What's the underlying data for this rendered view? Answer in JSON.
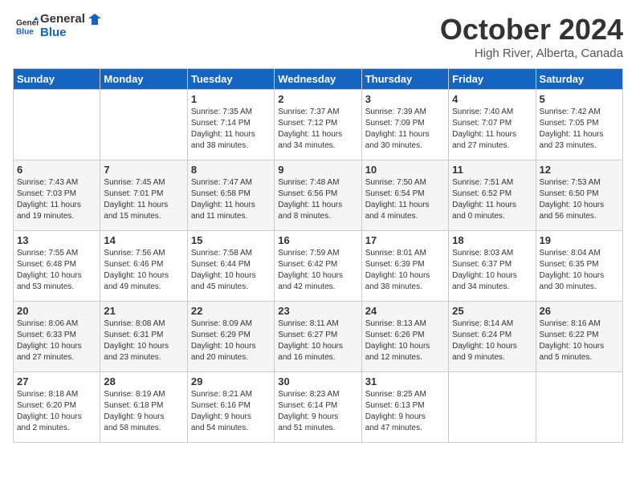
{
  "logo": {
    "line1": "General",
    "line2": "Blue"
  },
  "title": "October 2024",
  "location": "High River, Alberta, Canada",
  "weekdays": [
    "Sunday",
    "Monday",
    "Tuesday",
    "Wednesday",
    "Thursday",
    "Friday",
    "Saturday"
  ],
  "weeks": [
    [
      {
        "day": "",
        "info": ""
      },
      {
        "day": "",
        "info": ""
      },
      {
        "day": "1",
        "info": "Sunrise: 7:35 AM\nSunset: 7:14 PM\nDaylight: 11 hours\nand 38 minutes."
      },
      {
        "day": "2",
        "info": "Sunrise: 7:37 AM\nSunset: 7:12 PM\nDaylight: 11 hours\nand 34 minutes."
      },
      {
        "day": "3",
        "info": "Sunrise: 7:39 AM\nSunset: 7:09 PM\nDaylight: 11 hours\nand 30 minutes."
      },
      {
        "day": "4",
        "info": "Sunrise: 7:40 AM\nSunset: 7:07 PM\nDaylight: 11 hours\nand 27 minutes."
      },
      {
        "day": "5",
        "info": "Sunrise: 7:42 AM\nSunset: 7:05 PM\nDaylight: 11 hours\nand 23 minutes."
      }
    ],
    [
      {
        "day": "6",
        "info": "Sunrise: 7:43 AM\nSunset: 7:03 PM\nDaylight: 11 hours\nand 19 minutes."
      },
      {
        "day": "7",
        "info": "Sunrise: 7:45 AM\nSunset: 7:01 PM\nDaylight: 11 hours\nand 15 minutes."
      },
      {
        "day": "8",
        "info": "Sunrise: 7:47 AM\nSunset: 6:58 PM\nDaylight: 11 hours\nand 11 minutes."
      },
      {
        "day": "9",
        "info": "Sunrise: 7:48 AM\nSunset: 6:56 PM\nDaylight: 11 hours\nand 8 minutes."
      },
      {
        "day": "10",
        "info": "Sunrise: 7:50 AM\nSunset: 6:54 PM\nDaylight: 11 hours\nand 4 minutes."
      },
      {
        "day": "11",
        "info": "Sunrise: 7:51 AM\nSunset: 6:52 PM\nDaylight: 11 hours\nand 0 minutes."
      },
      {
        "day": "12",
        "info": "Sunrise: 7:53 AM\nSunset: 6:50 PM\nDaylight: 10 hours\nand 56 minutes."
      }
    ],
    [
      {
        "day": "13",
        "info": "Sunrise: 7:55 AM\nSunset: 6:48 PM\nDaylight: 10 hours\nand 53 minutes."
      },
      {
        "day": "14",
        "info": "Sunrise: 7:56 AM\nSunset: 6:46 PM\nDaylight: 10 hours\nand 49 minutes."
      },
      {
        "day": "15",
        "info": "Sunrise: 7:58 AM\nSunset: 6:44 PM\nDaylight: 10 hours\nand 45 minutes."
      },
      {
        "day": "16",
        "info": "Sunrise: 7:59 AM\nSunset: 6:42 PM\nDaylight: 10 hours\nand 42 minutes."
      },
      {
        "day": "17",
        "info": "Sunrise: 8:01 AM\nSunset: 6:39 PM\nDaylight: 10 hours\nand 38 minutes."
      },
      {
        "day": "18",
        "info": "Sunrise: 8:03 AM\nSunset: 6:37 PM\nDaylight: 10 hours\nand 34 minutes."
      },
      {
        "day": "19",
        "info": "Sunrise: 8:04 AM\nSunset: 6:35 PM\nDaylight: 10 hours\nand 30 minutes."
      }
    ],
    [
      {
        "day": "20",
        "info": "Sunrise: 8:06 AM\nSunset: 6:33 PM\nDaylight: 10 hours\nand 27 minutes."
      },
      {
        "day": "21",
        "info": "Sunrise: 8:08 AM\nSunset: 6:31 PM\nDaylight: 10 hours\nand 23 minutes."
      },
      {
        "day": "22",
        "info": "Sunrise: 8:09 AM\nSunset: 6:29 PM\nDaylight: 10 hours\nand 20 minutes."
      },
      {
        "day": "23",
        "info": "Sunrise: 8:11 AM\nSunset: 6:27 PM\nDaylight: 10 hours\nand 16 minutes."
      },
      {
        "day": "24",
        "info": "Sunrise: 8:13 AM\nSunset: 6:26 PM\nDaylight: 10 hours\nand 12 minutes."
      },
      {
        "day": "25",
        "info": "Sunrise: 8:14 AM\nSunset: 6:24 PM\nDaylight: 10 hours\nand 9 minutes."
      },
      {
        "day": "26",
        "info": "Sunrise: 8:16 AM\nSunset: 6:22 PM\nDaylight: 10 hours\nand 5 minutes."
      }
    ],
    [
      {
        "day": "27",
        "info": "Sunrise: 8:18 AM\nSunset: 6:20 PM\nDaylight: 10 hours\nand 2 minutes."
      },
      {
        "day": "28",
        "info": "Sunrise: 8:19 AM\nSunset: 6:18 PM\nDaylight: 9 hours\nand 58 minutes."
      },
      {
        "day": "29",
        "info": "Sunrise: 8:21 AM\nSunset: 6:16 PM\nDaylight: 9 hours\nand 54 minutes."
      },
      {
        "day": "30",
        "info": "Sunrise: 8:23 AM\nSunset: 6:14 PM\nDaylight: 9 hours\nand 51 minutes."
      },
      {
        "day": "31",
        "info": "Sunrise: 8:25 AM\nSunset: 6:13 PM\nDaylight: 9 hours\nand 47 minutes."
      },
      {
        "day": "",
        "info": ""
      },
      {
        "day": "",
        "info": ""
      }
    ]
  ]
}
